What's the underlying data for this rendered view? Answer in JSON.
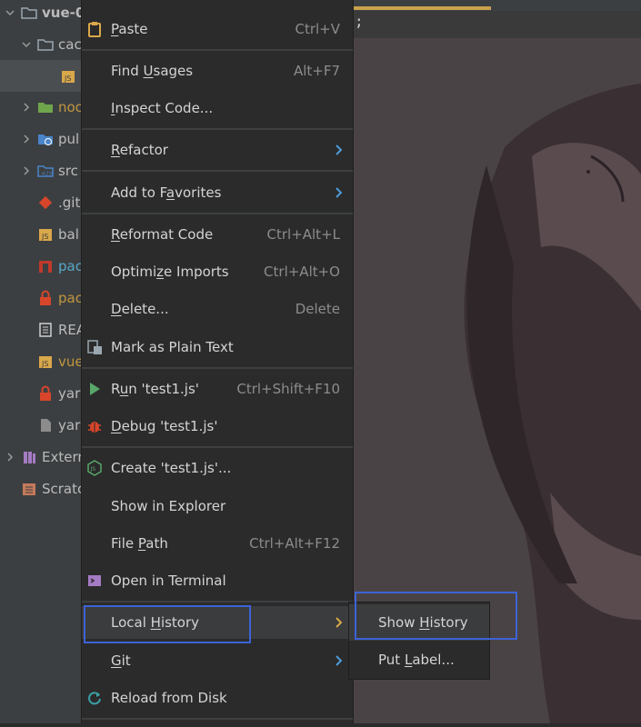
{
  "tree": {
    "items": [
      {
        "label": "vue-0",
        "arrow": "down",
        "icon": "folder-icon"
      },
      {
        "label": "cac",
        "arrow": "down",
        "icon": "folder-icon"
      },
      {
        "label": "",
        "arrow": "",
        "icon": "js-file-icon"
      },
      {
        "label": "noc",
        "arrow": "right",
        "icon": "node-modules-folder-icon"
      },
      {
        "label": "pul",
        "arrow": "right",
        "icon": "web-folder-icon"
      },
      {
        "label": "src",
        "arrow": "right",
        "icon": "source-folder-icon"
      },
      {
        "label": ".git",
        "arrow": "",
        "icon": "git-icon"
      },
      {
        "label": "bal",
        "arrow": "",
        "icon": "js-file-icon"
      },
      {
        "label": "pac",
        "arrow": "",
        "icon": "npm-icon"
      },
      {
        "label": "pac",
        "arrow": "",
        "icon": "lock-icon"
      },
      {
        "label": "REA",
        "arrow": "",
        "icon": "readme-icon"
      },
      {
        "label": "vue",
        "arrow": "",
        "icon": "js-file-icon"
      },
      {
        "label": "yar",
        "arrow": "",
        "icon": "lock-icon"
      },
      {
        "label": "yar",
        "arrow": "",
        "icon": "file-icon"
      },
      {
        "label": "Extern",
        "arrow": "right",
        "icon": "library-icon"
      },
      {
        "label": "Scratc",
        "arrow": "",
        "icon": "scratches-icon"
      }
    ]
  },
  "menu": {
    "paste": {
      "pre": "",
      "u": "P",
      "post": "aste",
      "shortcut": "Ctrl+V"
    },
    "find_usages": {
      "pre": "Find ",
      "u": "U",
      "post": "sages",
      "shortcut": "Alt+F7"
    },
    "inspect_code": {
      "pre": "",
      "u": "I",
      "post": "nspect Code...",
      "shortcut": ""
    },
    "refactor": {
      "pre": "",
      "u": "R",
      "post": "efactor",
      "shortcut": ""
    },
    "add_favorites": {
      "pre": "Add to F",
      "u": "a",
      "post": "vorites",
      "shortcut": ""
    },
    "reformat": {
      "pre": "",
      "u": "R",
      "post": "eformat Code",
      "shortcut": "Ctrl+Alt+L"
    },
    "optimize": {
      "pre": "Optimi",
      "u": "z",
      "post": "e Imports",
      "shortcut": "Ctrl+Alt+O"
    },
    "delete": {
      "pre": "",
      "u": "D",
      "post": "elete...",
      "shortcut": "Delete"
    },
    "mark_plain": {
      "pre": "Mark as Plain Text",
      "u": "",
      "post": "",
      "shortcut": ""
    },
    "run": {
      "pre": "R",
      "u": "u",
      "post": "n 'test1.js'",
      "shortcut": "Ctrl+Shift+F10"
    },
    "debug": {
      "pre": "",
      "u": "D",
      "post": "ebug 'test1.js'",
      "shortcut": ""
    },
    "create": {
      "pre": "Create 'test1.js'...",
      "u": "",
      "post": "",
      "shortcut": ""
    },
    "show_explorer": {
      "pre": "Show in Explorer",
      "u": "",
      "post": "",
      "shortcut": ""
    },
    "file_path": {
      "pre": "File ",
      "u": "P",
      "post": "ath",
      "shortcut": "Ctrl+Alt+F12"
    },
    "open_terminal": {
      "pre": "Open in Terminal",
      "u": "",
      "post": "",
      "shortcut": ""
    },
    "local_history": {
      "pre": "Local ",
      "u": "H",
      "post": "istory",
      "shortcut": ""
    },
    "git": {
      "pre": "",
      "u": "G",
      "post": "it",
      "shortcut": ""
    },
    "reload": {
      "pre": "Reload from Disk",
      "u": "",
      "post": "",
      "shortcut": ""
    }
  },
  "submenu": {
    "show_history": {
      "pre": "Show ",
      "u": "H",
      "post": "istory"
    },
    "put_label": {
      "pre": "Put ",
      "u": "L",
      "post": "abel..."
    }
  },
  "editor": {
    "semicolon": ";"
  },
  "colors": {
    "highlight": "#3d63d6",
    "menu_bg": "#2b2b2b",
    "hover_bg": "#3a3c3e"
  }
}
